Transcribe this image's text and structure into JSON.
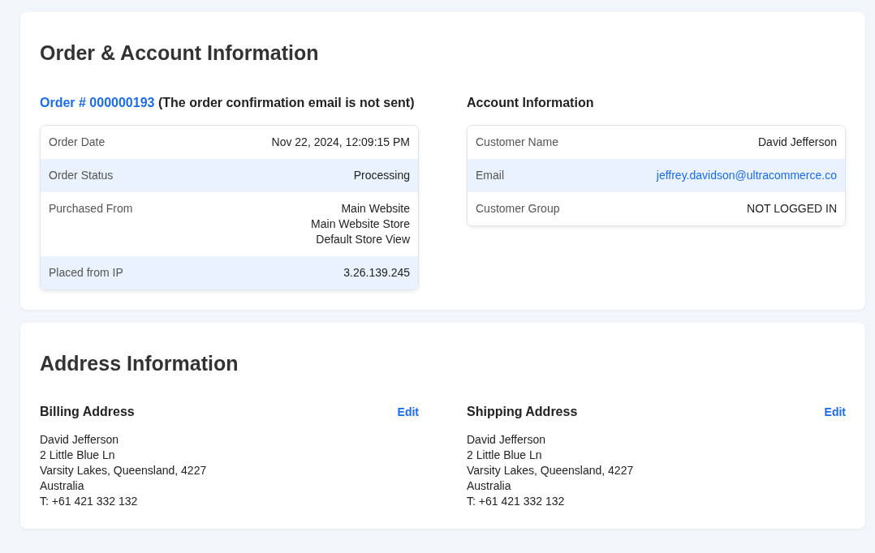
{
  "order_account": {
    "title": "Order & Account Information",
    "order": {
      "link": "Order # 000000193",
      "note": "(The order confirmation email is not sent)",
      "rows": [
        {
          "label": "Order Date",
          "lines": [
            "Nov 22, 2024, 12:09:15 PM"
          ]
        },
        {
          "label": "Order Status",
          "lines": [
            "Processing"
          ]
        },
        {
          "label": "Purchased From",
          "lines": [
            "Main Website",
            "Main Website Store",
            "Default Store View"
          ]
        },
        {
          "label": "Placed from IP",
          "lines": [
            "3.26.139.245"
          ]
        }
      ]
    },
    "account": {
      "heading": "Account Information",
      "rows": [
        {
          "label": "Customer Name",
          "kind": "text",
          "value": "David Jefferson"
        },
        {
          "label": "Email",
          "kind": "link",
          "value": "jeffrey.davidson@ultracommerce.co"
        },
        {
          "label": "Customer Group",
          "kind": "text",
          "value": "NOT LOGGED IN"
        }
      ]
    }
  },
  "address": {
    "title": "Address Information",
    "blocks": [
      {
        "heading": "Billing Address",
        "edit": "Edit",
        "lines": [
          "David Jefferson",
          "2 Little Blue Ln",
          "Varsity Lakes, Queensland, 4227",
          "Australia",
          "T: +61 421 332 132"
        ]
      },
      {
        "heading": "Shipping Address",
        "edit": "Edit",
        "lines": [
          "David Jefferson",
          "2 Little Blue Ln",
          "Varsity Lakes, Queensland, 4227",
          "Australia",
          "T: +61 421 332 132"
        ]
      }
    ]
  }
}
